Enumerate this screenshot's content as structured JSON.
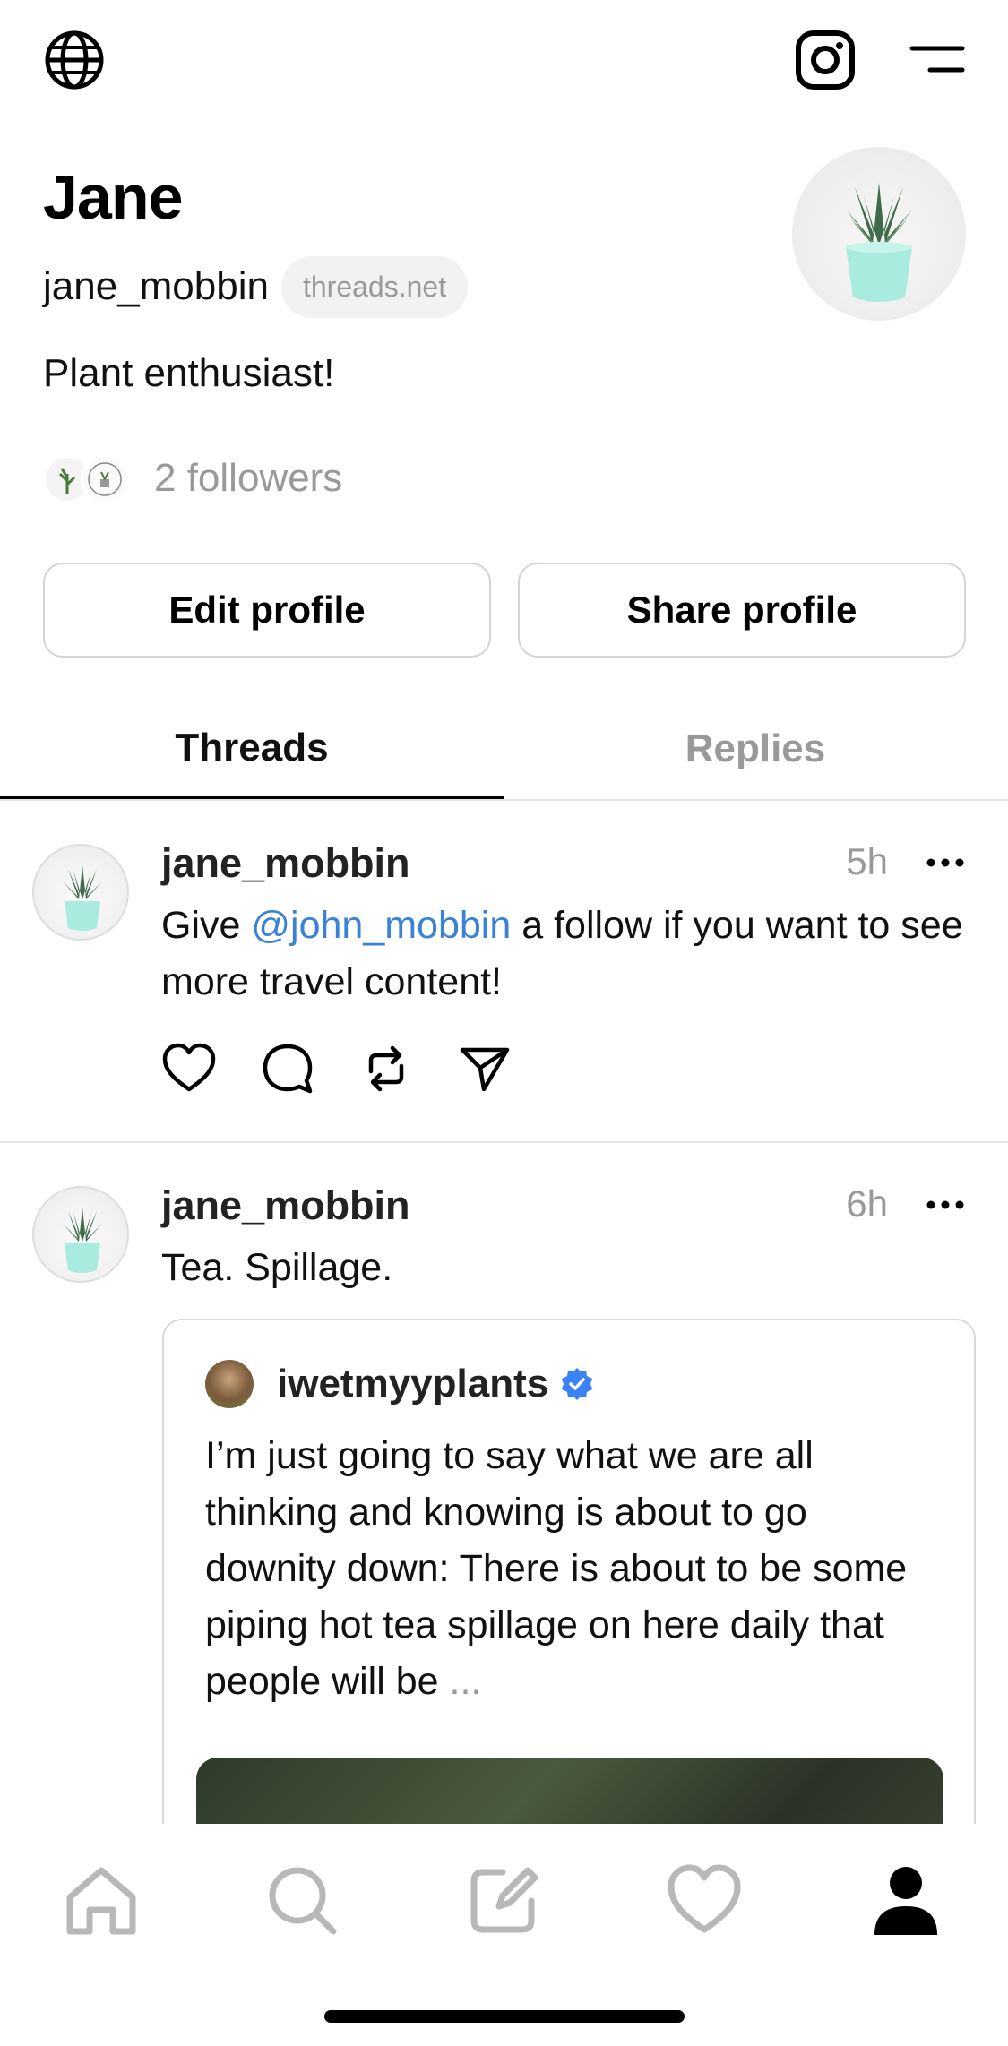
{
  "header": {
    "left_icon": "globe-icon",
    "right_icons": [
      "instagram-icon",
      "menu-icon"
    ]
  },
  "profile": {
    "name": "Jane",
    "handle": "jane_mobbin",
    "domain_badge": "threads.net",
    "bio": "Plant enthusiast!",
    "followers_text": "2 followers",
    "edit_button": "Edit profile",
    "share_button": "Share profile"
  },
  "tabs": [
    {
      "label": "Threads",
      "active": true
    },
    {
      "label": "Replies",
      "active": false
    }
  ],
  "posts": [
    {
      "user": "jane_mobbin",
      "time": "5h",
      "text_before": "Give ",
      "mention": "@john_mobbin",
      "text_after": " a follow if you want to see more travel content!"
    },
    {
      "user": "jane_mobbin",
      "time": "6h",
      "text": "Tea. Spillage.",
      "quote": {
        "user": "iwetmyyplants",
        "verified": true,
        "text": "I’m just going to say what we are all thinking and knowing is about to go downity down: There is about to be some piping hot tea spillage on here daily that people will be",
        "ellipsis": "..."
      }
    }
  ],
  "bottom_nav": [
    "home-icon",
    "search-icon",
    "compose-icon",
    "heart-icon",
    "profile-icon"
  ],
  "colors": {
    "accent_link": "#3b82d6",
    "verified": "#3b82f6",
    "muted_text": "#999999",
    "border": "#d4d4d4"
  }
}
